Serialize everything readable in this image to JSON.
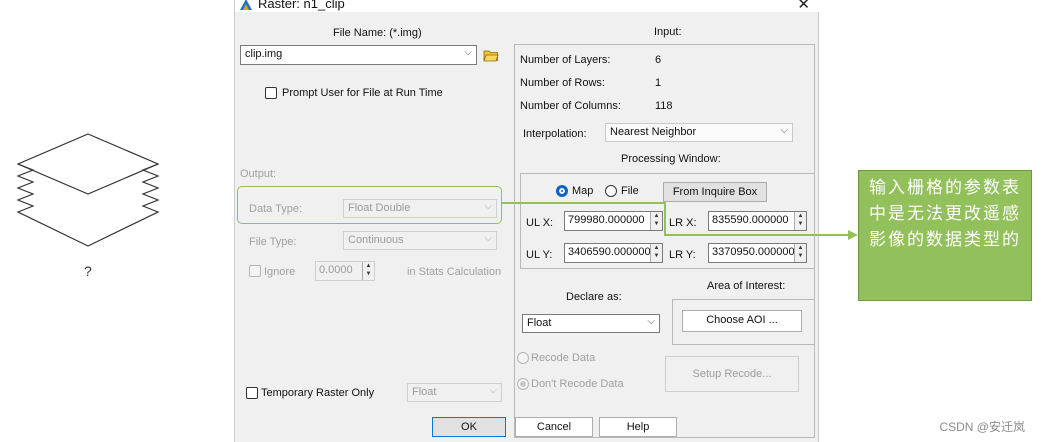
{
  "stack_label": "?",
  "title": "Raster: n1_clip",
  "close_glyph": "✕",
  "file_name": {
    "label": "File Name: (*.img)",
    "value": "clip.img"
  },
  "prompt_checkbox_label": "Prompt User for File at Run Time",
  "output": {
    "section_label": "Output:",
    "data_type_label": "Data Type:",
    "data_type_value": "Float Double",
    "file_type_label": "File Type:",
    "file_type_value": "Continuous",
    "ignore_label": "Ignore",
    "ignore_value": "0.0000",
    "stats_label": "in Stats Calculation"
  },
  "temp_raster_label": "Temporary Raster Only",
  "temp_raster_type": "Float",
  "input": {
    "section_label": "Input:",
    "num_layers_label": "Number of Layers:",
    "num_layers_value": "6",
    "num_rows_label": "Number of Rows:",
    "num_rows_value": "1",
    "num_cols_label": "Number of Columns:",
    "num_cols_value": "118",
    "interp_label": "Interpolation:",
    "interp_value": "Nearest Neighbor",
    "processing_window_label": "Processing Window:",
    "map_label": "Map",
    "file_label": "File",
    "from_inquire_label": "From Inquire Box",
    "ulx_label": "UL X:",
    "ulx_value": "799980.000000",
    "lrx_label": "LR X:",
    "lrx_value": "835590.000000",
    "uly_label": "UL Y:",
    "uly_value": "3406590.000000",
    "lry_label": "LR Y:",
    "lry_value": "3370950.000000",
    "declare_label": "Declare as:",
    "declare_value": "Float",
    "aoi_label": "Area of Interest:",
    "choose_aoi_label": "Choose AOI ...",
    "recode_label": "Recode Data",
    "dont_recode_label": "Don't Recode Data",
    "setup_recode_label": "Setup Recode..."
  },
  "buttons": {
    "ok": "OK",
    "cancel": "Cancel",
    "help": "Help"
  },
  "callout_text": "输入栅格的参数表中是无法更改遥感影像的数据类型的",
  "watermark": "CSDN @安迁岚",
  "colors": {
    "callout_bg": "#92c05a",
    "accent": "#0078d7"
  }
}
